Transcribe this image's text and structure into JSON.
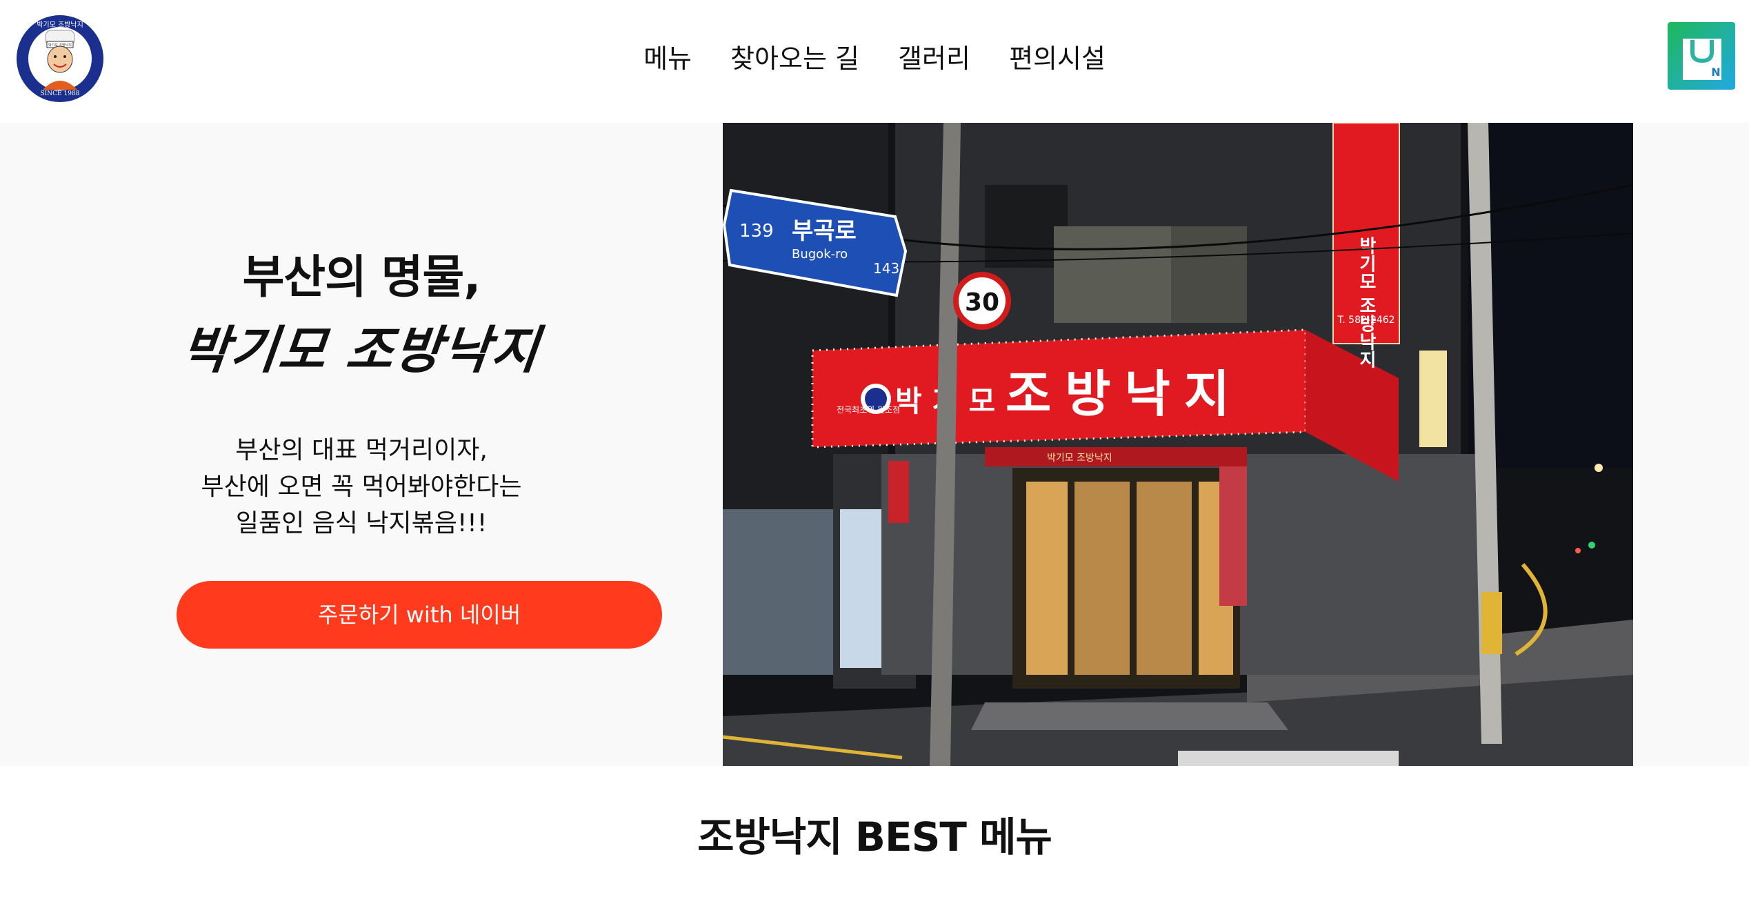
{
  "header": {
    "logo": {
      "arc_text": "박기모 조방낙지",
      "badge_text": "박기모 조방낙지",
      "since": "SINCE 1988"
    },
    "nav": [
      "메뉴",
      "찾아오는 길",
      "갤러리",
      "편의시설"
    ],
    "store_icon": "naver-smartstore-icon",
    "store_letter": "N"
  },
  "hero": {
    "title_line1": "부산의 명물,",
    "title_line2": "박기모 조방낙지",
    "description": [
      "부산의 대표 먹거리이자,",
      "부산에 오면 꼭 먹어봐야한다는",
      "일품인 음식 낙지볶음!!!"
    ],
    "order_button": "주문하기 with 네이버",
    "photo": {
      "street_sign": {
        "number_left": "139",
        "name": "부곡로",
        "roman": "Bugok-ro",
        "number_right": "143"
      },
      "speed_limit": "30",
      "sign_main": "조방낙지",
      "sign_prefix": "박 기 모",
      "sign_side": "전국최초의 원조점",
      "vertical_sign": "박기모 조방낙지",
      "vertical_phone": "T. 582-2462",
      "awning_label": "박기모 조방낙지"
    }
  },
  "best": {
    "title": "조방낙지 BEST 메뉴"
  },
  "colors": {
    "accent": "#ff3a1d",
    "logo_blue": "#1b2f8f",
    "sign_red": "#e11a22"
  }
}
